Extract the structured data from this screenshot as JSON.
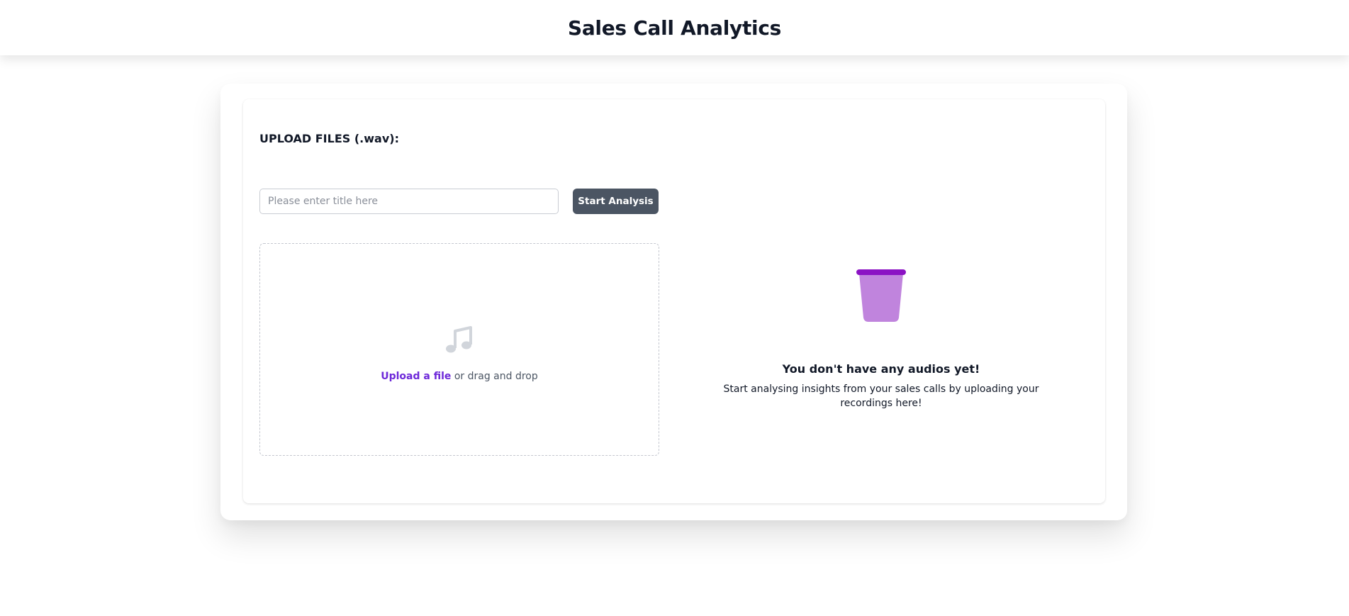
{
  "header": {
    "title": "Sales Call Analytics"
  },
  "upload": {
    "section_label": "UPLOAD FILES (.wav):",
    "title_input": {
      "value": "",
      "placeholder": "Please enter title here"
    },
    "start_button_label": "Start Analysis",
    "dropzone": {
      "icon": "music-note-icon",
      "link_text": "Upload a file",
      "suffix_text": " or drag and drop"
    }
  },
  "empty_state": {
    "icon": "empty-bin-icon",
    "title": "You don't have any audios yet!",
    "description": "Start analysing insights from your sales calls by uploading your recordings here!"
  },
  "colors": {
    "accent": "#6d28d9",
    "button_bg": "#4b5563",
    "bin_body": "#c084dd",
    "bin_rim": "#8b12c4"
  }
}
